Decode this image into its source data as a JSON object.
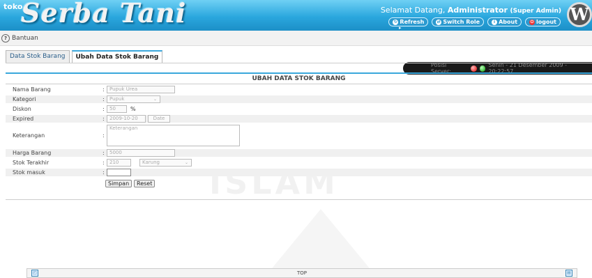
{
  "header": {
    "logo_prefix": "toko",
    "logo_name": "Serba Tani",
    "welcome_text": "Selamat Datang, ",
    "user_name": "Administrator",
    "user_role": "(Super Admin)",
    "buttons": [
      {
        "label": "Refresh",
        "icon": "refresh-icon"
      },
      {
        "label": "Switch Role",
        "icon": "switch-icon"
      },
      {
        "label": "About",
        "icon": "about-icon"
      },
      {
        "label": "logout",
        "icon": "logout-icon"
      }
    ],
    "brand_logo": "W"
  },
  "subbar": {
    "help_label": "Bantuan",
    "server_label": "Posisi Server:",
    "datetime": "Senin - 21 Desember 2009 - 20:22:57"
  },
  "tabs": [
    {
      "label": "Data Stok Barang",
      "active": false
    },
    {
      "label": "Ubah Data Stok Barang",
      "active": true
    }
  ],
  "form": {
    "title": "UBAH DATA STOK BARANG",
    "fields": {
      "nama_barang": {
        "label": "Nama Barang",
        "value": "Pupuk Urea"
      },
      "kategori": {
        "label": "Kategori",
        "value": "Pupuk"
      },
      "diskon": {
        "label": "Diskon",
        "value": "50",
        "unit": "%"
      },
      "expired": {
        "label": "Expired",
        "value": "2009-10-20",
        "button": "Date"
      },
      "keterangan": {
        "label": "Keterangan",
        "value": "Keterangan"
      },
      "harga_barang": {
        "label": "Harga Barang",
        "value": "5000"
      },
      "stok_terakhir": {
        "label": "Stok Terakhir",
        "value": "210",
        "unit_select": "Karung"
      },
      "stok_masuk": {
        "label": "Stok masuk",
        "value": ""
      }
    },
    "colon": ":",
    "save_label": "Simpan",
    "reset_label": "Reset"
  },
  "footer": {
    "top_label": "TOP"
  },
  "watermark": "ISLAM",
  "colors": {
    "accent": "#2aa7de",
    "status_bar": "#1a1a1a"
  }
}
